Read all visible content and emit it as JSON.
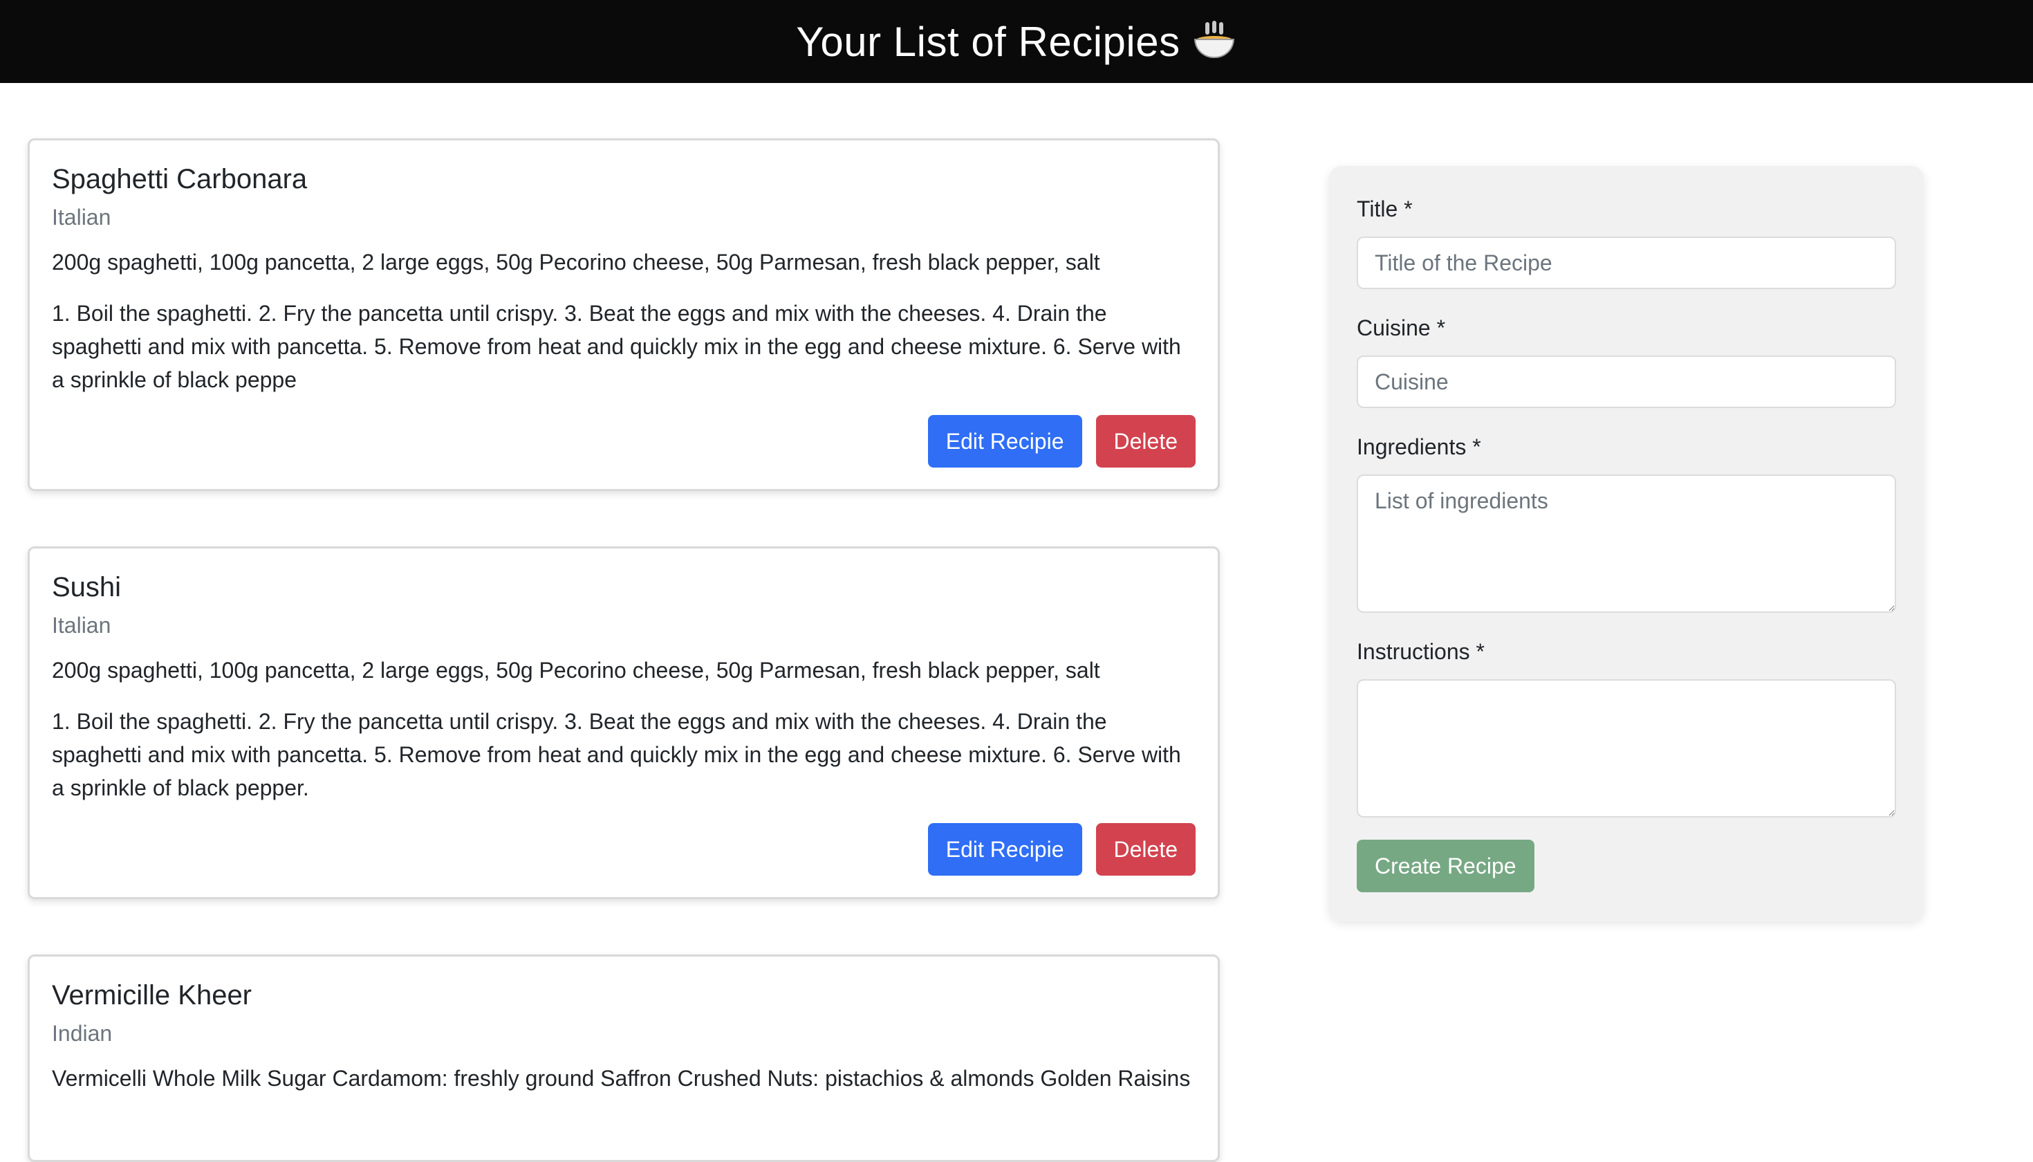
{
  "header": {
    "title": "Your List of Recipies",
    "emoji_icon": "bowl-with-steam-icon"
  },
  "recipes": [
    {
      "title": "Spaghetti Carbonara",
      "cuisine": "Italian",
      "ingredients": "200g spaghetti, 100g pancetta, 2 large eggs, 50g Pecorino cheese, 50g Parmesan, fresh black pepper, salt",
      "instructions": "1. Boil the spaghetti. 2. Fry the pancetta until crispy. 3. Beat the eggs and mix with the cheeses. 4. Drain the spaghetti and mix with pancetta. 5. Remove from heat and quickly mix in the egg and cheese mixture. 6. Serve with a sprinkle of black peppe",
      "edit_label": "Edit Recipie",
      "delete_label": "Delete"
    },
    {
      "title": "Sushi",
      "cuisine": "Italian",
      "ingredients": "200g spaghetti, 100g pancetta, 2 large eggs, 50g Pecorino cheese, 50g Parmesan, fresh black pepper, salt",
      "instructions": "1. Boil the spaghetti. 2. Fry the pancetta until crispy. 3. Beat the eggs and mix with the cheeses. 4. Drain the spaghetti and mix with pancetta. 5. Remove from heat and quickly mix in the egg and cheese mixture. 6. Serve with a sprinkle of black pepper.",
      "edit_label": "Edit Recipie",
      "delete_label": "Delete"
    },
    {
      "title": "Vermicille Kheer",
      "cuisine": "Indian",
      "ingredients": "Vermicelli Whole Milk Sugar Cardamom: freshly ground Saffron Crushed Nuts: pistachios & almonds Golden Raisins"
    }
  ],
  "form": {
    "title_label": "Title *",
    "title_placeholder": "Title of the Recipe",
    "title_value": "",
    "cuisine_label": "Cuisine *",
    "cuisine_placeholder": "Cuisine",
    "cuisine_value": "",
    "ingredients_label": "Ingredients *",
    "ingredients_placeholder": "List of ingredients",
    "ingredients_value": "",
    "instructions_label": "Instructions *",
    "instructions_placeholder": "",
    "instructions_value": "",
    "submit_label": "Create Recipe"
  },
  "colors": {
    "header_bg": "#0a0a0a",
    "edit_button": "#2f6ef5",
    "delete_button": "#d2434f",
    "create_button": "#77a884",
    "form_panel_bg": "#f1f1f1"
  }
}
